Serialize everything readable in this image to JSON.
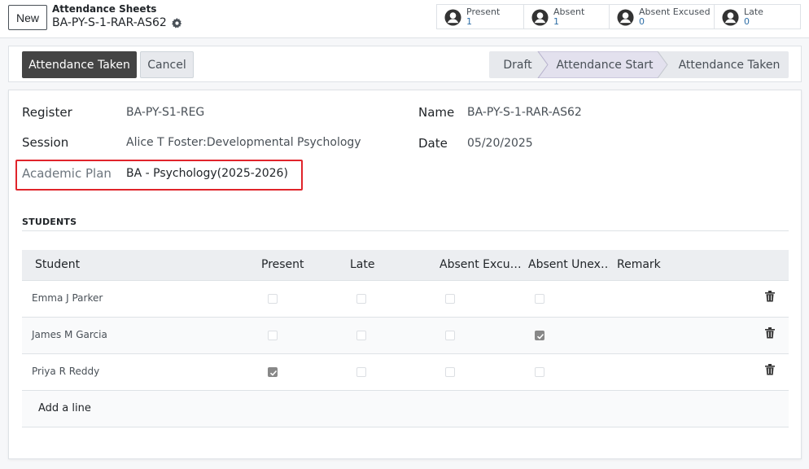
{
  "header": {
    "new_label": "New",
    "breadcrumb": "Attendance Sheets",
    "record_name": "BA-PY-S-1-RAR-AS62",
    "stats": [
      {
        "label": "Present",
        "value": "1"
      },
      {
        "label": "Absent",
        "value": "1"
      },
      {
        "label": "Absent Excused",
        "value": "0"
      },
      {
        "label": "Late",
        "value": "0"
      }
    ]
  },
  "controls": {
    "primary_label": "Attendance Taken",
    "cancel_label": "Cancel",
    "stages": [
      {
        "label": "Draft",
        "active": false
      },
      {
        "label": "Attendance Start",
        "active": true
      },
      {
        "label": "Attendance Taken",
        "active": false
      }
    ]
  },
  "form": {
    "register_label": "Register",
    "register_value": "BA-PY-S1-REG",
    "session_label": "Session",
    "session_value": "Alice T Foster:Developmental Psychology·",
    "plan_label": "Academic Plan",
    "plan_value": "BA - Psychology(2025-2026)",
    "name_label": "Name",
    "name_value": "BA-PY-S-1-RAR-AS62",
    "date_label": "Date",
    "date_value": "05/20/2025"
  },
  "students": {
    "section_title": "STUDENTS",
    "columns": [
      "Student",
      "Present",
      "Late",
      "Absent Excu…",
      "Absent Unex…",
      "Remark"
    ],
    "rows": [
      {
        "name": "Emma J Parker",
        "present": false,
        "late": false,
        "absent_excused": false,
        "absent_unexcused": false
      },
      {
        "name": "James M Garcia",
        "present": false,
        "late": false,
        "absent_excused": false,
        "absent_unexcused": true
      },
      {
        "name": "Priya R Reddy",
        "present": true,
        "late": false,
        "absent_excused": false,
        "absent_unexcused": false
      }
    ],
    "add_line": "Add a line"
  },
  "colors": {
    "accent_link": "#2f6fa7",
    "primary_button": "#444444",
    "active_stage": "#e6e4f0",
    "highlight_box": "#e0242b"
  }
}
